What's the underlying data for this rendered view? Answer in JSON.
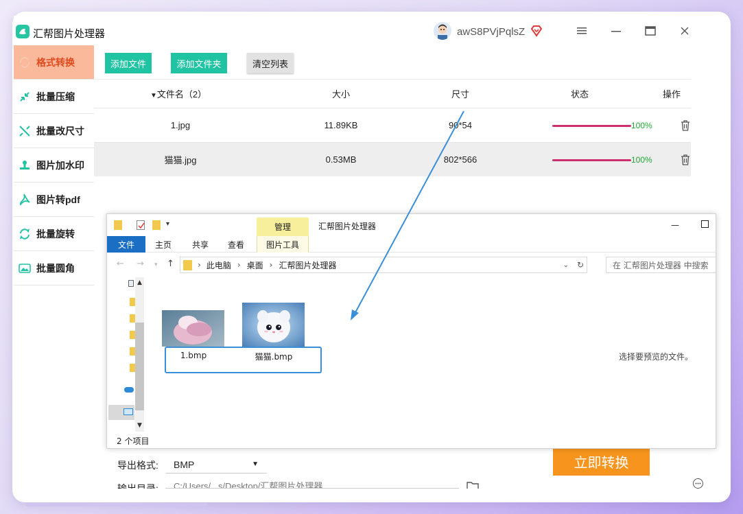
{
  "app": {
    "title": "汇帮图片处理器",
    "username": "awS8PVjPqlsZ",
    "controls": [
      "menu-icon",
      "minimize-icon",
      "maximize-icon",
      "close-icon"
    ]
  },
  "sidebar": {
    "items": [
      {
        "label": "格式转换",
        "icon": "convert-icon",
        "active": true
      },
      {
        "label": "批量压缩",
        "icon": "compress-icon"
      },
      {
        "label": "批量改尺寸",
        "icon": "resize-icon"
      },
      {
        "label": "图片加水印",
        "icon": "watermark-icon"
      },
      {
        "label": "图片转pdf",
        "icon": "pdf-icon"
      },
      {
        "label": "批量旋转",
        "icon": "rotate-icon"
      },
      {
        "label": "批量圆角",
        "icon": "round-corner-icon"
      }
    ]
  },
  "toolbar": {
    "add_file": "添加文件",
    "add_folder": "添加文件夹",
    "clear_list": "清空列表"
  },
  "table": {
    "headers": {
      "name": "文件名（2）",
      "size": "大小",
      "dims": "尺寸",
      "status": "状态",
      "action": "操作"
    },
    "rows": [
      {
        "name": "1.jpg",
        "size": "11.89KB",
        "dims": "90*54",
        "progress": 100,
        "progress_label": "100%"
      },
      {
        "name": "猫猫.jpg",
        "size": "0.53MB",
        "dims": "802*566",
        "progress": 100,
        "progress_label": "100%"
      }
    ]
  },
  "settings": {
    "export_format_label": "导出格式:",
    "export_format_value": "BMP",
    "output_dir_label": "输出目录:",
    "output_dir_value": "C:/Users/...s/Desktop/汇帮图片处理器",
    "convert_button": "立即转换"
  },
  "explorer": {
    "manage_tab": "管理",
    "title": "汇帮图片处理器",
    "ribbon_tabs": [
      "文件",
      "主页",
      "共享",
      "查看",
      "图片工具"
    ],
    "breadcrumb": [
      "此电脑",
      "桌面",
      "汇帮图片处理器"
    ],
    "search_placeholder": "在 汇帮图片处理器 中搜索",
    "files": [
      {
        "name": "1.bmp"
      },
      {
        "name": "猫猫.bmp"
      }
    ],
    "preview_hint": "选择要预览的文件。",
    "item_count": "2 个项目"
  },
  "colors": {
    "accent_green": "#20c3a2",
    "active_sidebar_bg": "#f9b99a",
    "active_sidebar_text": "#e04a1e",
    "progress_bar": "#cc2f6e",
    "progress_text": "#1ea830",
    "convert_button": "#f7941d",
    "annotation_arrow": "#3a8fd9"
  }
}
